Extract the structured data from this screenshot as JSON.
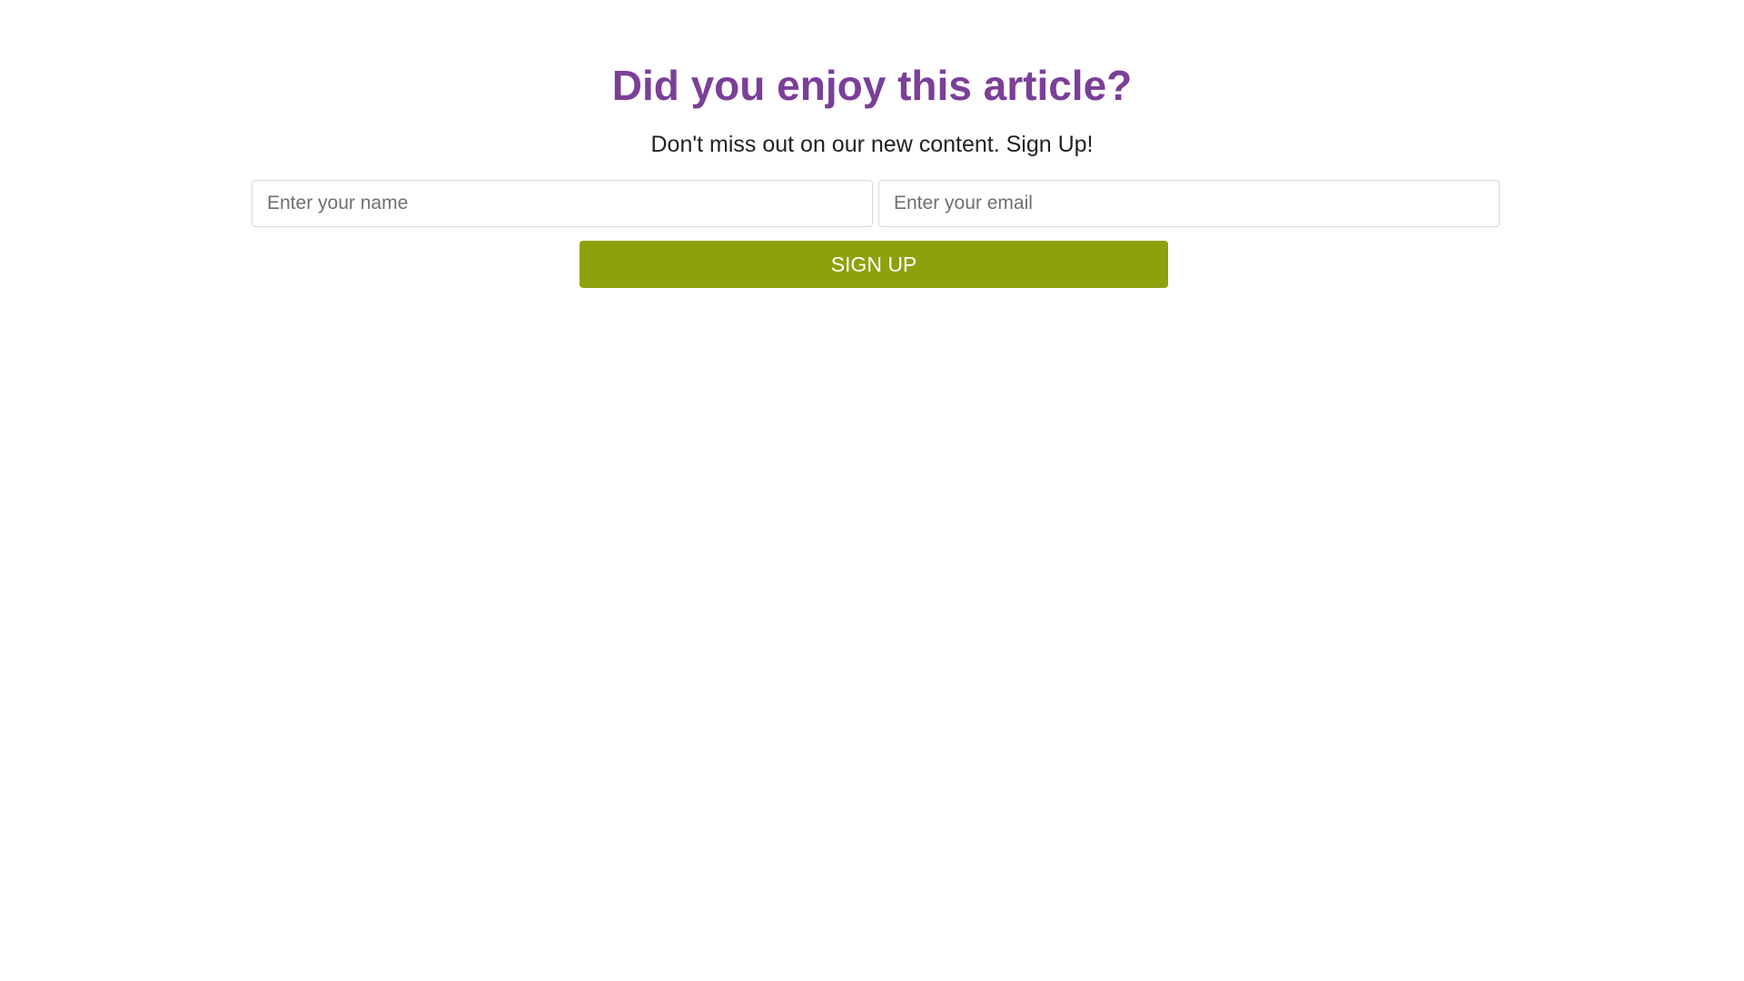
{
  "signup": {
    "title": "Did you enjoy this article?",
    "subtitle": "Don't miss out on our new content. Sign Up!",
    "name_placeholder": "Enter your name",
    "email_placeholder": "Enter your email",
    "button_label": "SIGN UP"
  },
  "colors": {
    "title": "#7b3f98",
    "button": "#8fa00d",
    "button_text": "#ffffff"
  }
}
